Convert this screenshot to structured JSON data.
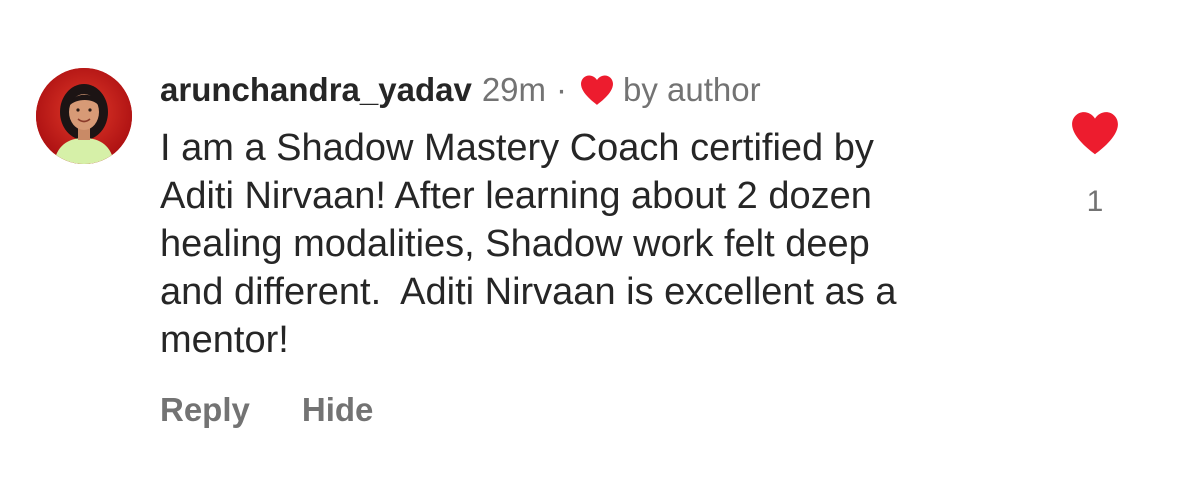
{
  "comment": {
    "username": "arunchandra_yadav",
    "time_ago": "29m",
    "separator": "·",
    "author_badge_label": "by author",
    "author_badge_icon": "heart-icon",
    "text": "I am a Shadow Mastery Coach certified by\nAditi Nirvaan! After learning about 2 dozen\nhealing modalities, Shadow work felt deep\nand different.  Aditi Nirvaan is excellent as a\nmentor!",
    "like_count": "1",
    "like_icon": "heart-icon",
    "liked": true,
    "actions": {
      "reply": "Reply",
      "hide": "Hide"
    }
  },
  "colors": {
    "heart": "#ed1c2e",
    "text": "#262626",
    "secondary": "#737373",
    "avatar_ring": "#c81818"
  }
}
